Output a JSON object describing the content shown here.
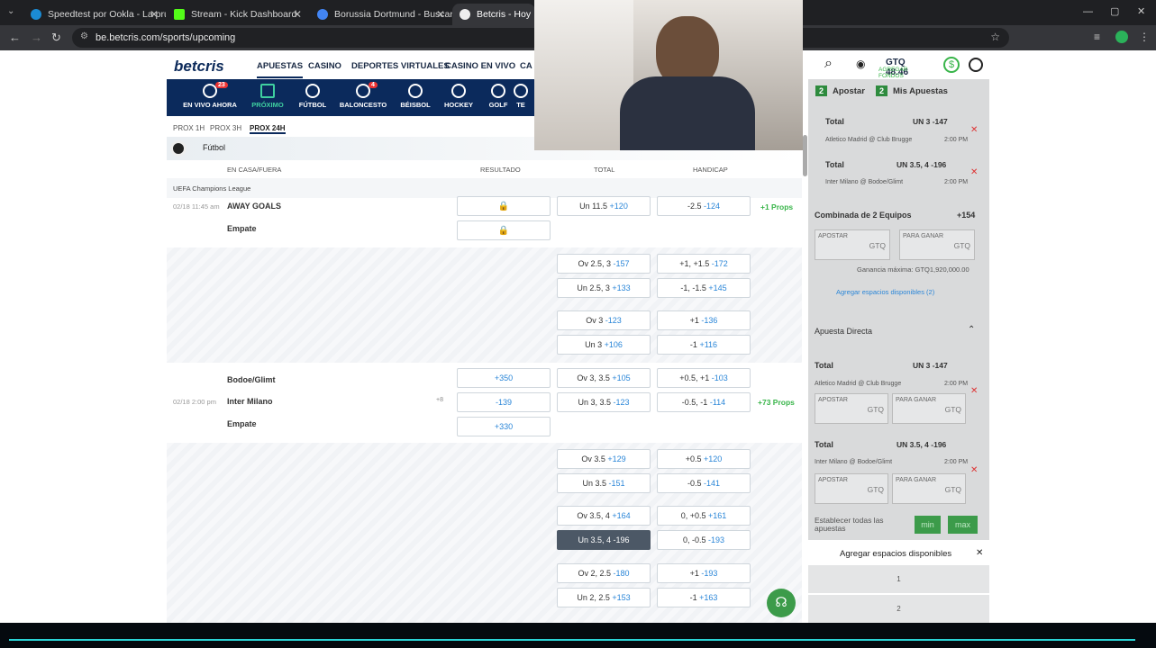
{
  "browser": {
    "tabs": [
      {
        "title": "Speedtest por Ookla - La prueb",
        "color": "#1b8bd4"
      },
      {
        "title": "Stream - Kick Dashboard",
        "color": "#53fc18"
      },
      {
        "title": "Borussia Dortmund - Buscar co",
        "color": "#4285f4"
      },
      {
        "title": "Betcris - Hoy",
        "color": "#eeeeee"
      }
    ],
    "url": "be.betcris.com/sports/upcoming"
  },
  "site": {
    "logo": "betcris",
    "menu": [
      "APUESTAS",
      "CASINO",
      "DEPORTES VIRTUALES",
      "CASINO EN VIVO",
      "CA"
    ],
    "balance": "GTQ 48.46",
    "balance_sub": "AGREGAR FONDOS"
  },
  "sports": [
    {
      "label": "EN VIVO AHORA",
      "badge": "23"
    },
    {
      "label": "PRÓXIMO",
      "badge": ""
    },
    {
      "label": "FÚTBOL",
      "badge": ""
    },
    {
      "label": "BALONCESTO",
      "badge": "4"
    },
    {
      "label": "BÉISBOL",
      "badge": ""
    },
    {
      "label": "HOCKEY",
      "badge": ""
    },
    {
      "label": "GOLF",
      "badge": ""
    },
    {
      "label": "TE",
      "badge": ""
    }
  ],
  "subtabs": [
    "PROX 1H",
    "PROX 3H",
    "PROX 24H"
  ],
  "sport_row": "Fútbol",
  "columns": [
    "EN CASA/FUERA",
    "RESULTADO",
    "TOTAL",
    "HANDICAP"
  ],
  "league": "UEFA Champions League",
  "match1": {
    "date": "02/18 11:45 am",
    "line1": "AWAY GOALS",
    "line2": "Empate",
    "total": [
      "Un 11.5",
      "+120"
    ],
    "handicap": [
      "-2.5",
      "-124"
    ],
    "props": "+1 Props"
  },
  "alt_lines1": [
    {
      "t": [
        "Ov 2.5, 3",
        "-157"
      ],
      "h": [
        "+1, +1.5",
        "-172"
      ]
    },
    {
      "t": [
        "Un 2.5, 3",
        "+133"
      ],
      "h": [
        "-1, -1.5",
        "+145"
      ]
    },
    {
      "t": [
        "Ov 3",
        "-123"
      ],
      "h": [
        "+1",
        "-136"
      ]
    },
    {
      "t": [
        "Un 3",
        "+106"
      ],
      "h": [
        "-1",
        "+116"
      ]
    }
  ],
  "match2": {
    "date": "02/18 2:00 pm",
    "teams": [
      "Bodoe/Glimt",
      "Inter Milano",
      "Empate"
    ],
    "result": [
      "+350",
      "-139",
      "+330"
    ],
    "total": [
      [
        "Ov 3, 3.5",
        "+105"
      ],
      [
        "Un 3, 3.5",
        "-123"
      ]
    ],
    "handicap": [
      [
        "+0.5, +1",
        "-103"
      ],
      [
        "-0.5, -1",
        "-114"
      ]
    ],
    "props": "+73 Props",
    "more": "+8"
  },
  "alt_lines2": [
    {
      "t": [
        "Ov 3.5",
        "+129"
      ],
      "h": [
        "+0.5",
        "+120"
      ]
    },
    {
      "t": [
        "Un 3.5",
        "-151"
      ],
      "h": [
        "-0.5",
        "-141"
      ]
    },
    {
      "t": [
        "Ov 3.5, 4",
        "+164"
      ],
      "h": [
        "0, +0.5",
        "+161"
      ]
    },
    {
      "t": [
        "Un 3.5, 4",
        "-196"
      ],
      "h": [
        "0, -0.5",
        "-193"
      ]
    },
    {
      "t": [
        "Ov 2, 2.5",
        "-180"
      ],
      "h": [
        "+1",
        "-193"
      ]
    },
    {
      "t": [
        "Un 2, 2.5",
        "+153"
      ],
      "h": [
        "-1",
        "+163"
      ]
    }
  ],
  "betslip": {
    "tab1": {
      "count": "2",
      "label": "Apostar"
    },
    "tab2": {
      "count": "2",
      "label": "Mis Apuestas"
    },
    "legs": [
      {
        "label": "Total",
        "sel": "UN 3 -147",
        "match": "Atletico Madrid @ Club Brugge",
        "time": "2:00 PM"
      },
      {
        "label": "Total",
        "sel": "UN 3.5, 4 -196",
        "match": "Inter Milano @ Bodoe/Glimt",
        "time": "2:00 PM"
      }
    ],
    "combo_label": "Combinada de 2 Equipos",
    "combo_odds": "+154",
    "stake_label": "APOSTAR",
    "win_label": "PARA GANAR",
    "currency": "GTQ",
    "max_win": "Ganancia máxima: GTQ1,920,000.00",
    "add_slots": "Agregar espacios disponibles (2)",
    "direct": "Apuesta Directa",
    "set_all": "Establecer todas las apuestas",
    "min": "min",
    "max": "max"
  },
  "add_panel": {
    "title": "Agregar espacios disponibles",
    "options": [
      "1",
      "2"
    ]
  }
}
